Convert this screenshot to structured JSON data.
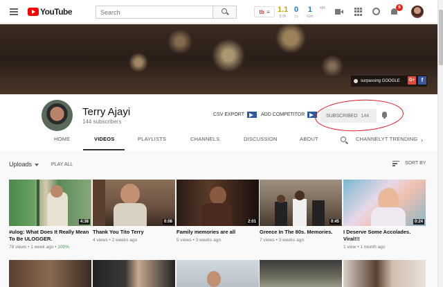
{
  "header": {
    "logo_text": "YouTube",
    "search_placeholder": "Search",
    "ext_label": "tb",
    "stats": [
      {
        "num": "1.1",
        "lbl": "8 0h",
        "color": "#c9a400"
      },
      {
        "num": "0",
        "lbl": "1y",
        "color": "#1a73e8"
      },
      {
        "num": "1",
        "lbl": "60m",
        "color": "#1a73e8"
      },
      {
        "num": "",
        "lbl": "48h",
        "color": "#1a73e8"
      }
    ],
    "notification_count": "6"
  },
  "banner": {
    "link_label": "surpassing GOOGLE",
    "gplus": "G+",
    "fb": "f"
  },
  "channel": {
    "name": "Terry Ajayi",
    "subscribers": "144 subscribers",
    "csv_export": "CSV EXPORT",
    "add_competitor": "ADD COMPETITOR",
    "subscribed_label": "SUBSCRIBED",
    "subscribed_count": "144"
  },
  "tabs": [
    "HOME",
    "VIDEOS",
    "PLAYLISTS",
    "CHANNELS",
    "DISCUSSION",
    "ABOUT",
    "CHANNELYT TRENDING"
  ],
  "toolbar": {
    "uploads": "Uploads",
    "play_all": "PLAY ALL",
    "sort_by": "SORT BY"
  },
  "videos": [
    {
      "title": "#ulog: What Does It Really Mean To Be ULOGGER.",
      "views": "78 views",
      "age": "1 week ago",
      "pct": "100%",
      "duration": "4:38"
    },
    {
      "title": "Thank You Tito Terry",
      "views": "4 views",
      "age": "2 weeks ago",
      "pct": "",
      "duration": "0:08"
    },
    {
      "title": "Family memories are all",
      "views": "5 views",
      "age": "3 weeks ago",
      "pct": "",
      "duration": "2:01"
    },
    {
      "title": "Greece In The 80s. Memories.",
      "views": "7 views",
      "age": "3 weeks ago",
      "pct": "",
      "duration": "0:45"
    },
    {
      "title": "I Deserve Some Accolades. Viral!!!",
      "views": "1 view",
      "age": "1 month ago",
      "pct": "",
      "duration": "0:24"
    }
  ]
}
